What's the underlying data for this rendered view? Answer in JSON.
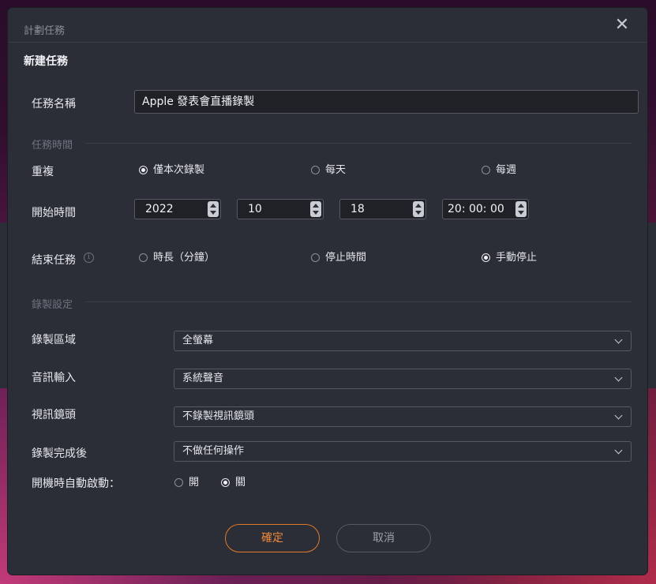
{
  "dialog": {
    "window_title": "計劃任務",
    "heading": "新建任務"
  },
  "task_name": {
    "label": "任務名稱",
    "value": "Apple 發表會直播錄製"
  },
  "task_time": {
    "section_label": "任務時間",
    "repeat_label": "重複",
    "repeat_options": [
      {
        "label": "僅本次錄製",
        "checked": true
      },
      {
        "label": "每天",
        "checked": false
      },
      {
        "label": "每週",
        "checked": false
      }
    ],
    "start_label": "開始時間",
    "start_year": "2022",
    "start_month": "10",
    "start_day": "18",
    "start_time": "20: 00: 00",
    "end_label": "結束任務",
    "end_options": [
      {
        "label": "時長（分鐘）",
        "checked": false
      },
      {
        "label": "停止時間",
        "checked": false
      },
      {
        "label": "手動停止",
        "checked": true
      }
    ]
  },
  "record_settings": {
    "section_label": "錄製設定",
    "area_label": "錄製區域",
    "area_value": "全螢幕",
    "audio_label": "音訊輸入",
    "audio_value": "系統聲音",
    "webcam_label": "視訊鏡頭",
    "webcam_value": "不錄製視訊鏡頭",
    "after_label": "錄製完成後",
    "after_value": "不做任何操作",
    "autostart_label": "開機時自動啟動：",
    "autostart_options": [
      {
        "label": "開",
        "checked": false
      },
      {
        "label": "關",
        "checked": true
      }
    ]
  },
  "buttons": {
    "ok": "確定",
    "cancel": "取消"
  },
  "colors": {
    "accent": "#f08a3a",
    "dialog_bg": "#2b2e36"
  },
  "icons": [
    "close-icon",
    "info-icon",
    "spin-up-icon",
    "spin-down-icon",
    "chevron-down-icon"
  ]
}
